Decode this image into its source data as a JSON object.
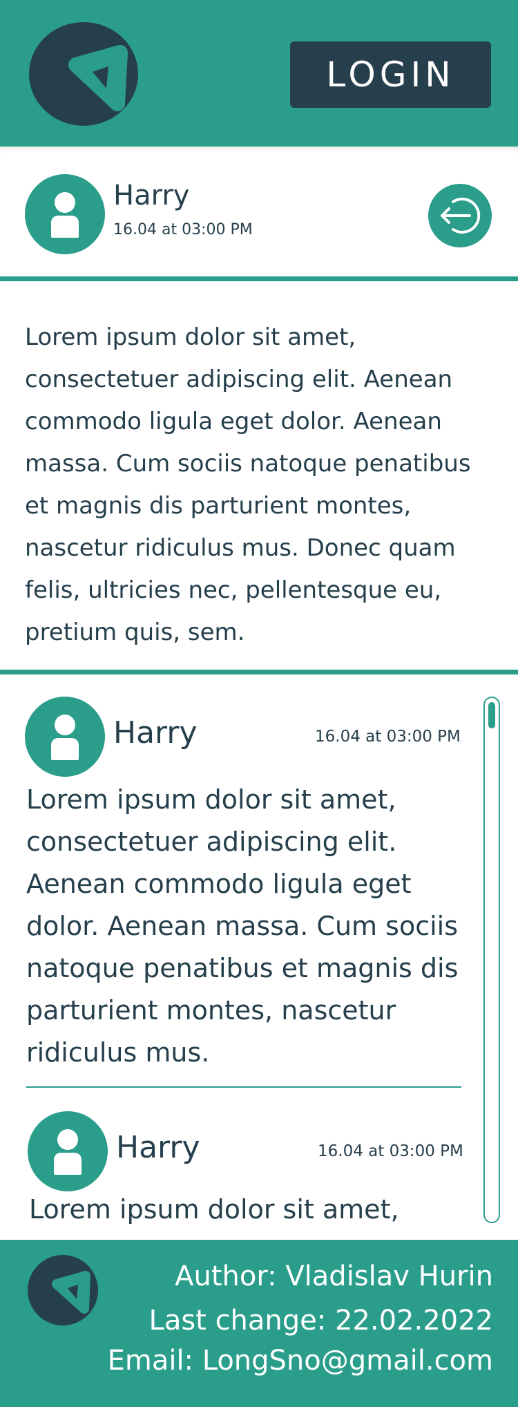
{
  "header": {
    "logo_icon": "app-logo-icon",
    "login_label": "LOGIN"
  },
  "post": {
    "author": "Harry",
    "time": "16.04 at 03:00 PM",
    "avatar_icon": "user-avatar-icon",
    "logout_icon": "logout-icon",
    "text": "Lorem ipsum dolor sit amet, consectetuer adipiscing elit. Aenean commodo ligula eget dolor. Aenean massa. Cum sociis natoque penatibus et magnis dis parturient montes, nascetur ridiculus mus. Donec quam felis, ultricies nec, pellentesque eu, pretium quis, sem."
  },
  "comments": [
    {
      "author": "Harry",
      "time": "16.04 at 03:00 PM",
      "text": "Lorem ipsum dolor sit amet, consectetuer adipiscing elit. Aenean commodo ligula eget dolor. Aenean massa. Cum sociis natoque penatibus et magnis dis parturient montes, nascetur ridiculus mus."
    },
    {
      "author": "Harry",
      "time": "16.04 at 03:00 PM",
      "text": "Lorem ipsum dolor sit amet,"
    }
  ],
  "footer": {
    "author_line": "Author: Vladislav Hurin",
    "last_change_line": "Last change: 22.02.2022",
    "email_line": "Email: LongSno@gmail.com"
  },
  "colors": {
    "teal": "#2a9d8b",
    "navy": "#263f4c",
    "white": "#ffffff"
  }
}
